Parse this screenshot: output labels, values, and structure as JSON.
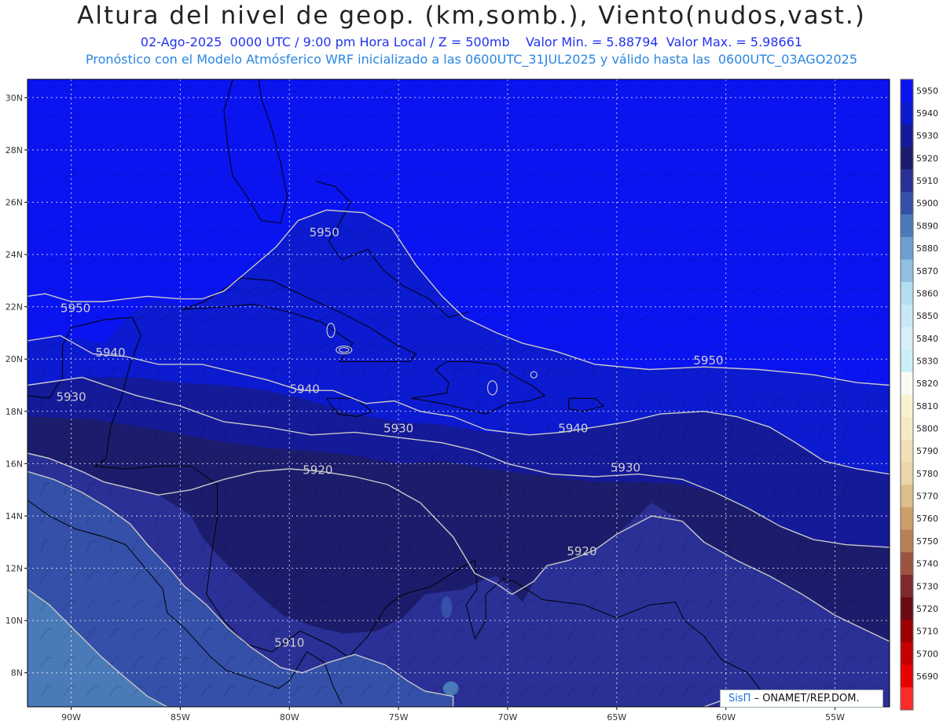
{
  "header": {
    "title": "Altura del nivel de geop. (km,somb.), Viento(nudos,vast.)",
    "line2": "02-Ago-2025  0000 UTC / 9:00 pm Hora Local / Z = 500mb    Valor Min. = 5.88794  Valor Max. = 5.98661",
    "line3": "Pronóstico con el Modelo Atmósferico WRF inicializado a las 0600UTC_31JUL2025 y válido hasta las  0600UTC_03AGO2025"
  },
  "map": {
    "lon_range": [
      -92,
      -52.5
    ],
    "lat_range": [
      6.7,
      30.7
    ],
    "lat_ticks": [
      {
        "value": 30,
        "label": "30N"
      },
      {
        "value": 28,
        "label": "28N"
      },
      {
        "value": 26,
        "label": "26N"
      },
      {
        "value": 24,
        "label": "24N"
      },
      {
        "value": 22,
        "label": "22N"
      },
      {
        "value": 20,
        "label": "20N"
      },
      {
        "value": 18,
        "label": "18N"
      },
      {
        "value": 16,
        "label": "16N"
      },
      {
        "value": 14,
        "label": "14N"
      },
      {
        "value": 12,
        "label": "12N"
      },
      {
        "value": 10,
        "label": "10N"
      },
      {
        "value": 8,
        "label": "8N"
      }
    ],
    "lon_ticks": [
      {
        "value": -90,
        "label": "90W"
      },
      {
        "value": -85,
        "label": "85W"
      },
      {
        "value": -80,
        "label": "80W"
      },
      {
        "value": -75,
        "label": "75W"
      },
      {
        "value": -70,
        "label": "70W"
      },
      {
        "value": -65,
        "label": "65W"
      },
      {
        "value": -60,
        "label": "60W"
      },
      {
        "value": -55,
        "label": "55W"
      }
    ],
    "contours": [
      {
        "label": "5950",
        "lon": -78.4,
        "lat": 24.7
      },
      {
        "label": "5950",
        "lon": -89.8,
        "lat": 21.8
      },
      {
        "label": "5950",
        "lon": -60.8,
        "lat": 19.8
      },
      {
        "label": "5940",
        "lon": -88.2,
        "lat": 20.1
      },
      {
        "label": "5940",
        "lon": -79.3,
        "lat": 18.7
      },
      {
        "label": "5940",
        "lon": -67.0,
        "lat": 17.2
      },
      {
        "label": "5930",
        "lon": -90.0,
        "lat": 18.4
      },
      {
        "label": "5930",
        "lon": -75.0,
        "lat": 17.2
      },
      {
        "label": "5930",
        "lon": -64.6,
        "lat": 15.7
      },
      {
        "label": "5920",
        "lon": -78.7,
        "lat": 15.6
      },
      {
        "label": "5920",
        "lon": -66.6,
        "lat": 12.5
      },
      {
        "label": "5910",
        "lon": -80.0,
        "lat": 9.0
      }
    ],
    "colorbar": [
      {
        "label": "5950",
        "color": "#0a14f0"
      },
      {
        "label": "5940",
        "color": "#0c1ad0"
      },
      {
        "label": "5930",
        "color": "#141a98"
      },
      {
        "label": "5920",
        "color": "#1c1c6c"
      },
      {
        "label": "5910",
        "color": "#2a3096"
      },
      {
        "label": "5900",
        "color": "#3450a8"
      },
      {
        "label": "5890",
        "color": "#4a7ab8"
      },
      {
        "label": "5880",
        "color": "#6c9ed0"
      },
      {
        "label": "5870",
        "color": "#90bfe2"
      },
      {
        "label": "5860",
        "color": "#b4ddf0"
      },
      {
        "label": "5850",
        "color": "#c8e8f6"
      },
      {
        "label": "5840",
        "color": "#d8f0f8"
      },
      {
        "label": "5830",
        "color": "#cbeff6"
      },
      {
        "label": "5820",
        "color": "#fbfaf2"
      },
      {
        "label": "5810",
        "color": "#f8f2d0"
      },
      {
        "label": "5800",
        "color": "#f4eac4"
      },
      {
        "label": "5790",
        "color": "#f0e0b8"
      },
      {
        "label": "5780",
        "color": "#ead6a8"
      },
      {
        "label": "5770",
        "color": "#dcbe8c"
      },
      {
        "label": "5760",
        "color": "#cc9e68"
      },
      {
        "label": "5750",
        "color": "#b88054"
      },
      {
        "label": "5740",
        "color": "#9c5440"
      },
      {
        "label": "5730",
        "color": "#7e2a30"
      },
      {
        "label": "5720",
        "color": "#6a0a12"
      },
      {
        "label": "5710",
        "color": "#9c0000"
      },
      {
        "label": "5700",
        "color": "#c40000"
      },
      {
        "label": "5690",
        "color": "#e80000"
      },
      {
        "label": "",
        "color": "#ff2a2a"
      }
    ],
    "colors": {
      "band_5950": "#0a14f0",
      "band_5940": "#0c1ad0",
      "band_5930": "#141a98",
      "band_5920": "#1c1c6c",
      "band_5910": "#2a3096",
      "band_5900": "#3450a8",
      "band_5890": "#4a7ab8",
      "contour": "#c8c8c8"
    }
  },
  "credit": {
    "logo": "SisΠ",
    "text": "– ONAMET/REP.DOM."
  }
}
